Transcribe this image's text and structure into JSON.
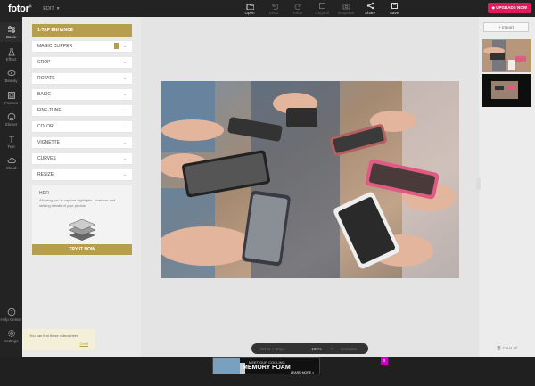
{
  "header": {
    "logo": "fotor",
    "logo_mark": "®",
    "edit_menu": "EDIT",
    "tools": [
      {
        "label": "Open",
        "icon": "open-icon",
        "enabled": true
      },
      {
        "label": "Undo",
        "icon": "undo-icon",
        "enabled": false
      },
      {
        "label": "Redo",
        "icon": "redo-icon",
        "enabled": false
      },
      {
        "label": "Original",
        "icon": "original-icon",
        "enabled": false
      },
      {
        "label": "Snapshot",
        "icon": "snapshot-icon",
        "enabled": false
      },
      {
        "label": "Share",
        "icon": "share-icon",
        "enabled": true
      },
      {
        "label": "Save",
        "icon": "save-icon",
        "enabled": true
      }
    ],
    "upgrade_label": "UPGRADE NOW"
  },
  "sidebar": {
    "items": [
      {
        "label": "Basic",
        "icon": "sliders-icon"
      },
      {
        "label": "Effect",
        "icon": "flask-icon"
      },
      {
        "label": "Beauty",
        "icon": "eye-icon"
      },
      {
        "label": "Frames",
        "icon": "frame-icon"
      },
      {
        "label": "Sticker",
        "icon": "sticker-icon"
      },
      {
        "label": "Text",
        "icon": "text-icon"
      },
      {
        "label": "Cloud",
        "icon": "cloud-icon"
      }
    ],
    "bottom_items": [
      {
        "label": "Help Center",
        "icon": "help-icon"
      },
      {
        "label": "Settings",
        "icon": "settings-icon"
      }
    ]
  },
  "panel": {
    "enhance_label": "1-TAP ENHANCE",
    "menu": [
      "MAGIC CLIPPER",
      "CROP",
      "ROTATE",
      "BASIC",
      "FINE-TUNE",
      "COLOR",
      "VIGNETTE",
      "CURVES",
      "RESIZE"
    ],
    "promo_title": "HDR",
    "promo_desc": "Allowing you to capture highlights, shadows and striking details of your photos!",
    "try_label": "TRY IT NOW"
  },
  "tooltip": {
    "message": "You can find these videos here",
    "action": "Got it"
  },
  "zoom": {
    "size": "0Wpx × 0Hpx",
    "minus": "−",
    "value": "100%",
    "plus": "+",
    "compare": "Compare"
  },
  "right_panel": {
    "import_label": "Import",
    "clear_label": "Clear All"
  },
  "ad": {
    "line1": "MEET OUR COOLING",
    "line2": "MEMORY FOAM",
    "cta": "LEARN MORE >",
    "close": "x"
  },
  "colors": {
    "accent": "#b79d4e",
    "upgrade": "#e8175d",
    "topbar": "#232323"
  }
}
